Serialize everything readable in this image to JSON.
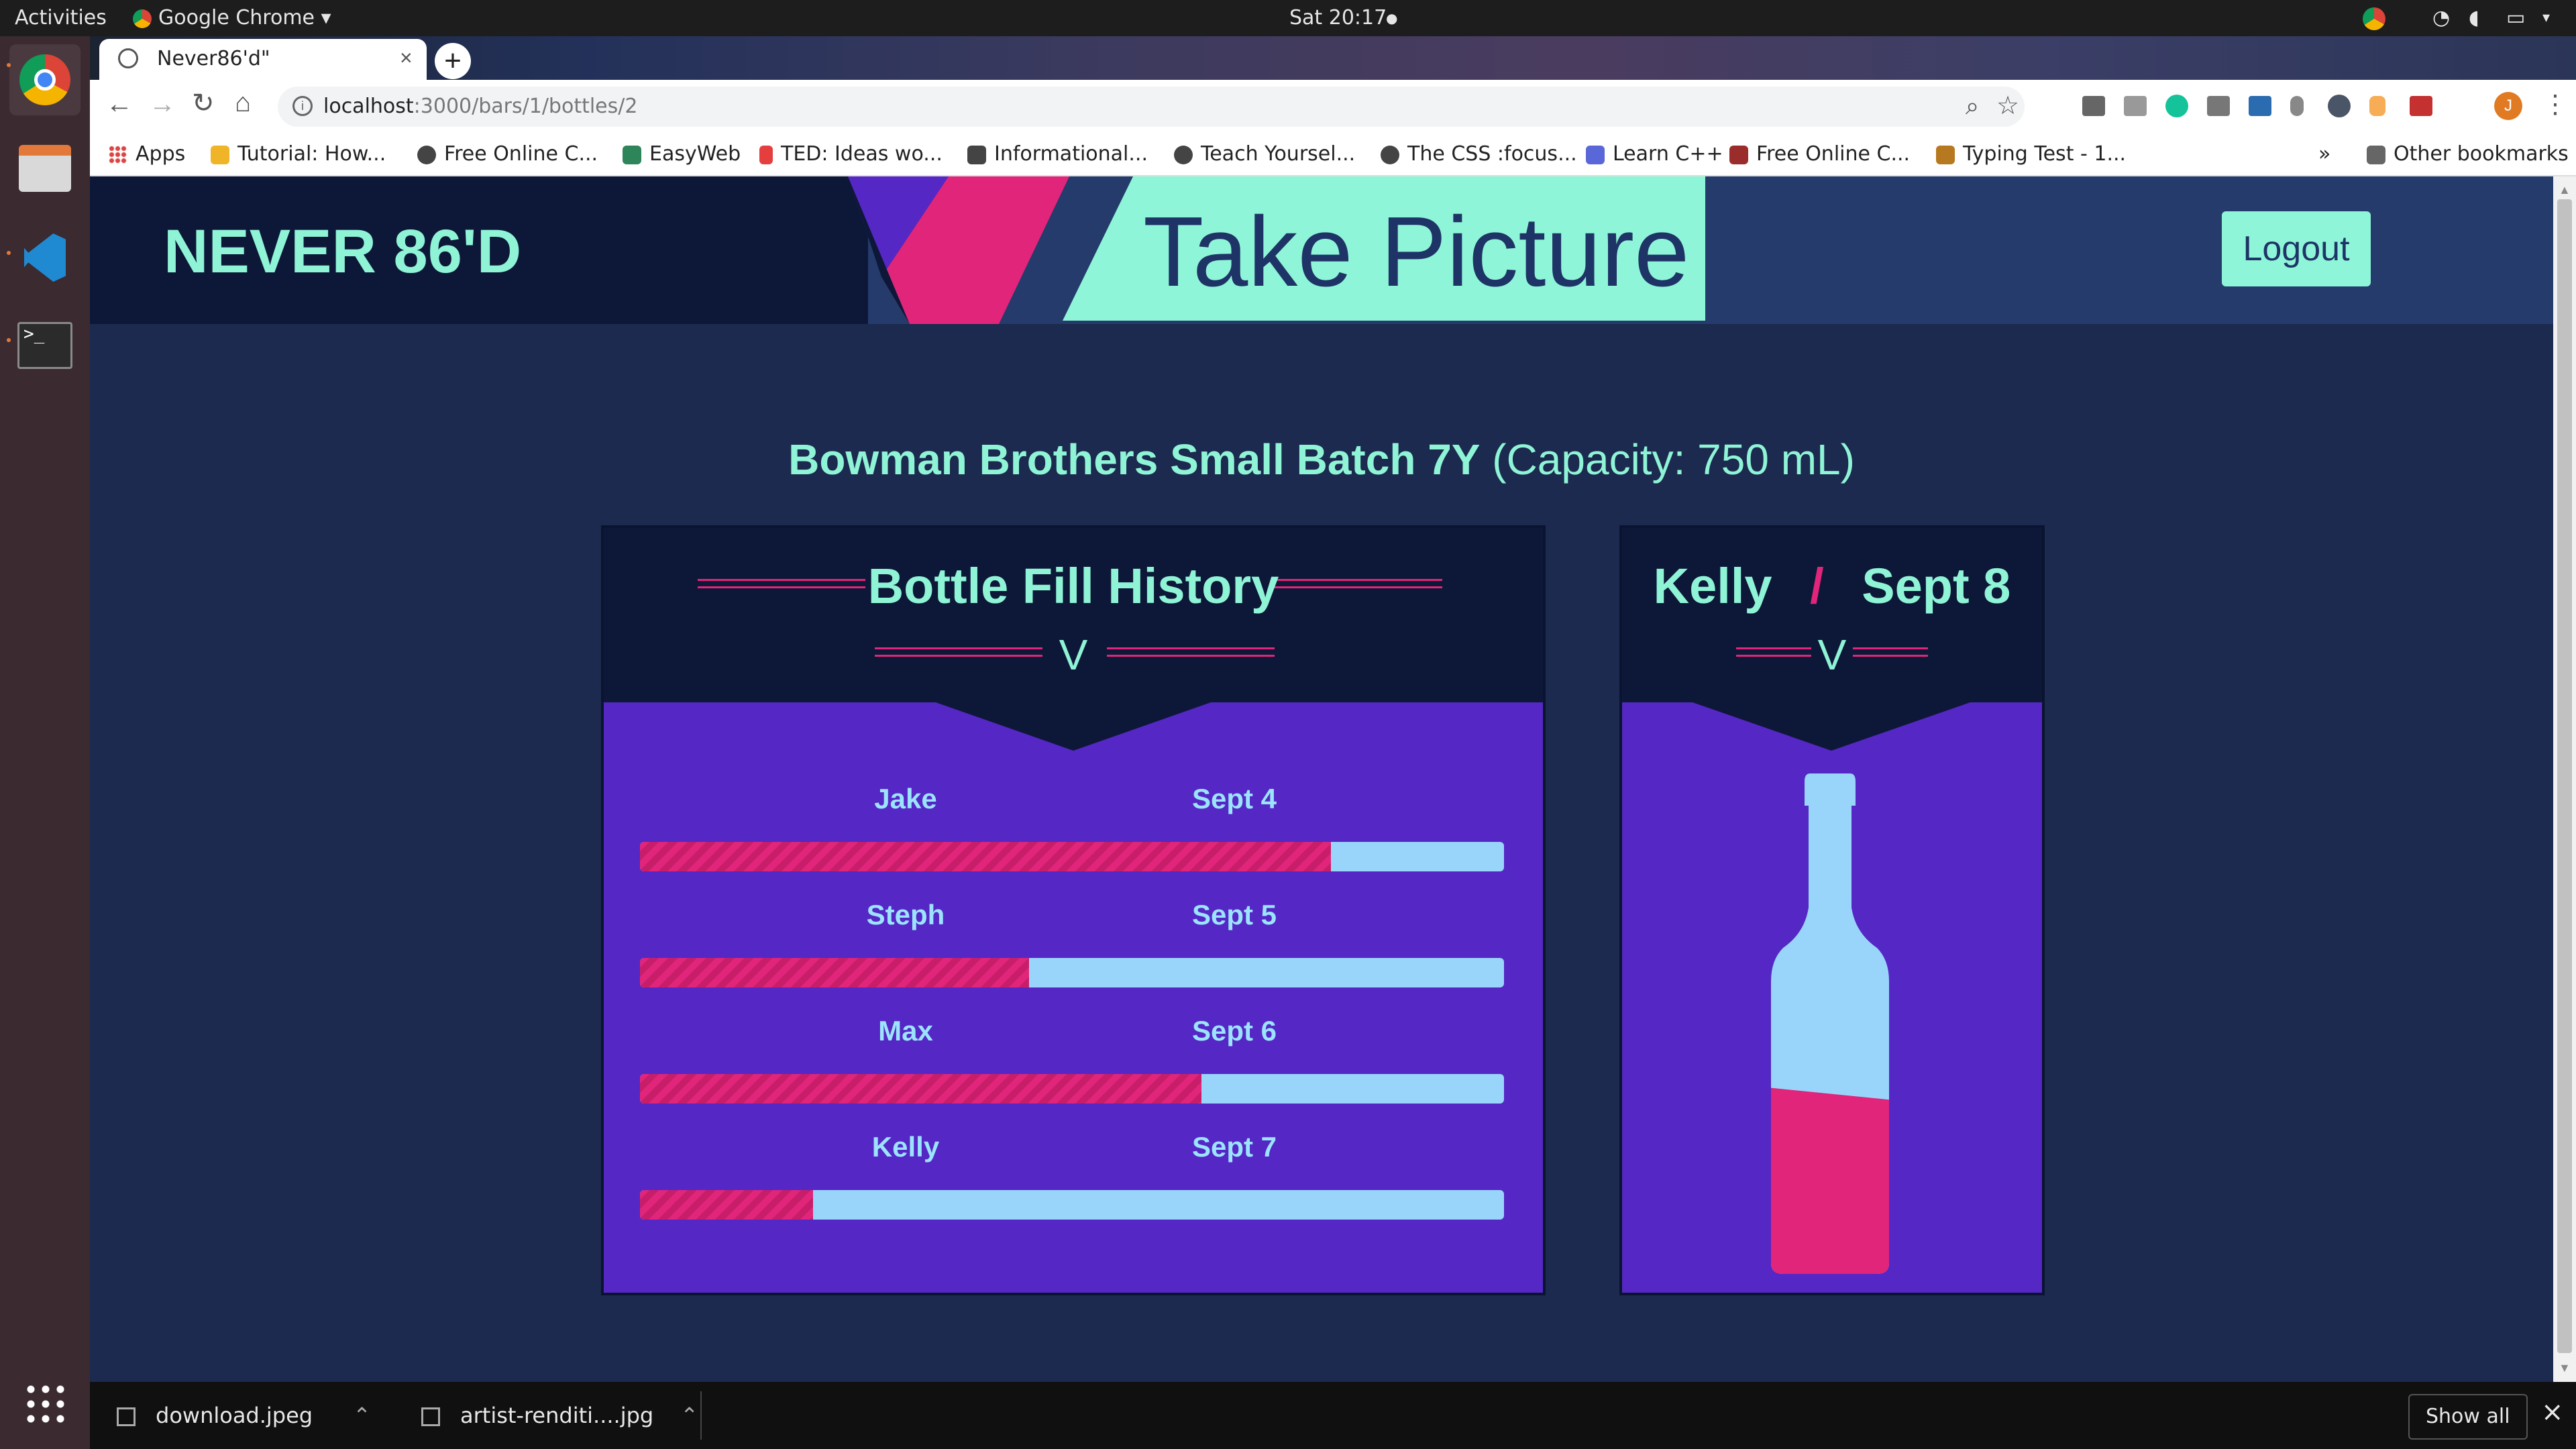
{
  "os_bar": {
    "activities": "Activities",
    "app_name": "Google Chrome",
    "clock": "Sat 20:17"
  },
  "dock": {
    "apps": [
      "chrome-icon",
      "files-icon",
      "vscode-icon",
      "terminal-icon"
    ],
    "show_apps_icon": "grid-icon"
  },
  "browser": {
    "tab_title": "Never86'd\"",
    "url_host": "localhost",
    "url_path": ":3000/bars/1/bottles/2",
    "bookmarks": [
      "Apps",
      "Tutorial: How...",
      "Free Online C...",
      "EasyWeb",
      "TED: Ideas wo...",
      "Informational...",
      "Teach Yoursel...",
      "The CSS :focus...",
      "Learn C++",
      "Free Online C...",
      "Typing Test - 1..."
    ],
    "more_bookmarks": "»",
    "other_bookmarks": "Other bookmarks"
  },
  "header": {
    "brand": "NEVER 86'D",
    "page_title": "Take Picture",
    "logout_label": "Logout"
  },
  "bottle": {
    "name": "Bowman Brothers Small Batch 7Y",
    "capacity": "(Capacity: 750 mL)"
  },
  "history": {
    "title": "Bottle Fill History",
    "caret": "V",
    "rows": [
      {
        "name": "Jake",
        "date": "Sept 4",
        "fill": 0.8
      },
      {
        "name": "Steph",
        "date": "Sept 5",
        "fill": 0.45
      },
      {
        "name": "Max",
        "date": "Sept 6",
        "fill": 0.65
      },
      {
        "name": "Kelly",
        "date": "Sept 7",
        "fill": 0.2
      }
    ]
  },
  "current": {
    "name": "Kelly",
    "separator": "/",
    "date": "Sept 8",
    "caret": "V",
    "fill": 0.36
  },
  "downloads": {
    "items": [
      "download.jpeg",
      "artist-renditi....jpg"
    ],
    "show_all": "Show all",
    "close": "×"
  },
  "colors": {
    "accent": "#8ff3d6",
    "pink": "#e0257a",
    "purple": "#5527c4",
    "light_blue": "#99d5fb",
    "navy": "#0d1838"
  }
}
